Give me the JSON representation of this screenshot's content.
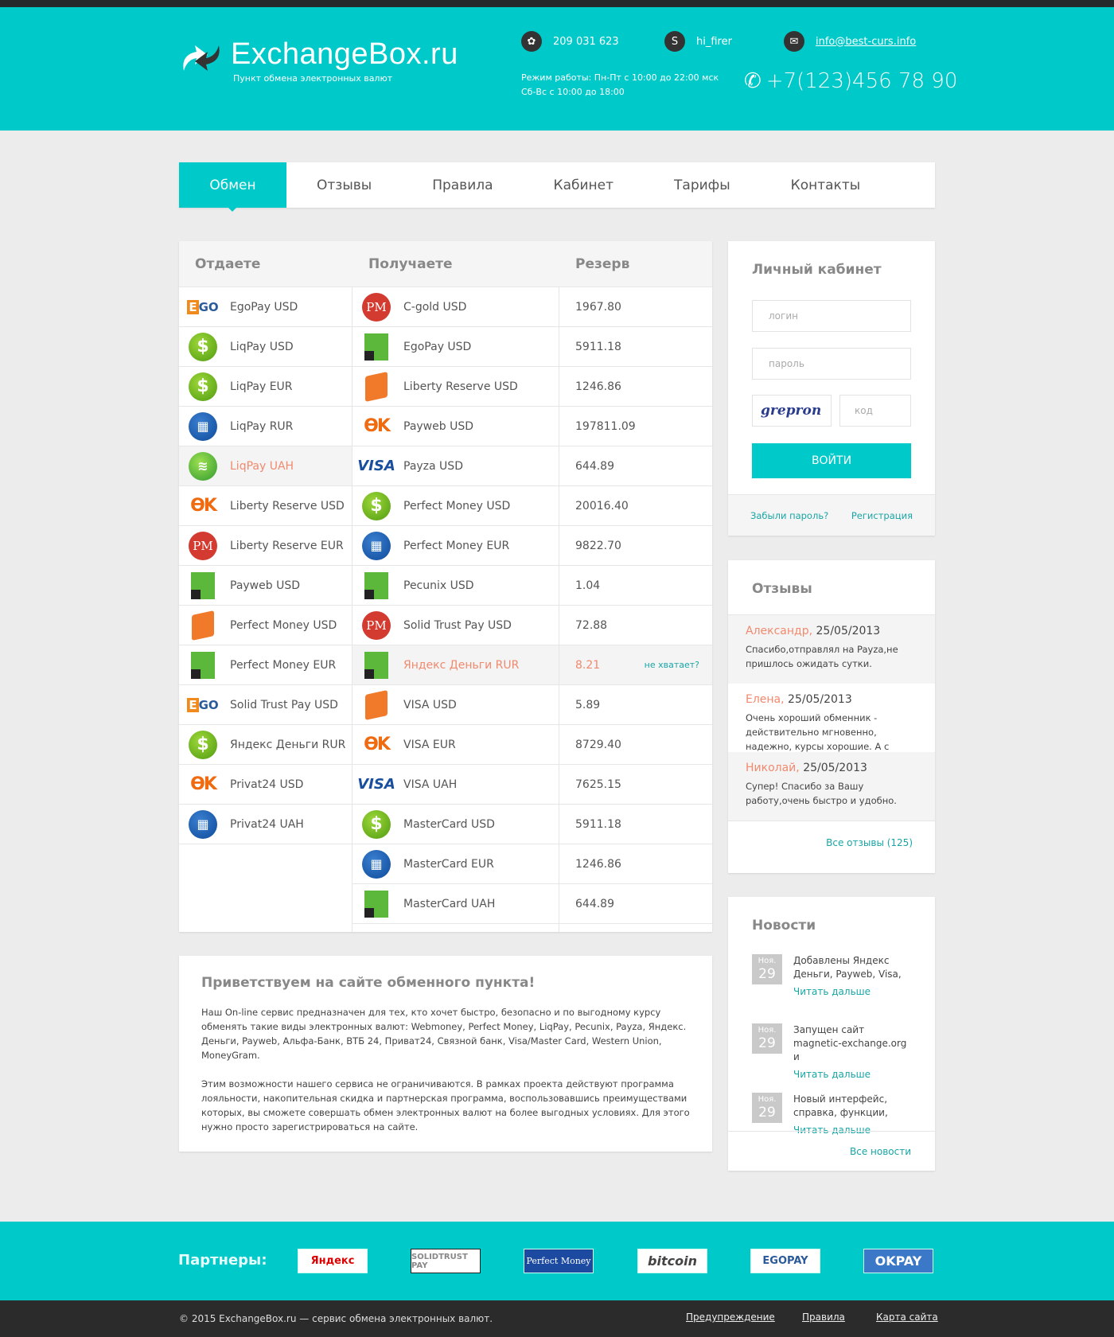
{
  "header": {
    "title": "ExchangeBox.ru",
    "subtitle": "Пункт обмена электронных валют",
    "icq": "209 031 623",
    "skype": "hi_firer",
    "email": "info@best-curs.info",
    "hours_line1": "Режим работы: Пн-Пт с 10:00 до 22:00 мск",
    "hours_line2": "Сб-Вс с 10:00 до 18:00",
    "phone": "+7(123)456 78 90"
  },
  "nav": {
    "tabs": [
      "Обмен",
      "Отзывы",
      "Правила",
      "Кабинет",
      "Тарифы",
      "Контакты"
    ],
    "active": 0
  },
  "table": {
    "headers": [
      "Отдаете",
      "Получаете",
      "Резерв"
    ],
    "give": [
      [
        "EgoPay USD",
        "egopay"
      ],
      [
        "LiqPay USD",
        "liqpay"
      ],
      [
        "LiqPay EUR",
        "liqpay"
      ],
      [
        "LiqPay RUR",
        "webmoney"
      ],
      [
        "LiqPay UAH",
        "sber"
      ],
      [
        "Liberty Reserve USD",
        "okpay"
      ],
      [
        "Liberty Reserve EUR",
        "pm"
      ],
      [
        "Payweb USD",
        "privat"
      ],
      [
        "Perfect Money USD",
        "wallet"
      ],
      [
        "Perfect Money EUR",
        "privat"
      ],
      [
        "Solid Trust Pay USD",
        "egopay"
      ],
      [
        "Яндекс Деньги RUR",
        "liqpay"
      ],
      [
        "Privat24 USD",
        "okpay"
      ],
      [
        "Privat24 UAH",
        "webmoney"
      ]
    ],
    "give_highlight": 4,
    "get": [
      [
        "C-gold USD",
        "pm",
        "1967.80"
      ],
      [
        "EgoPay USD",
        "privat",
        "5911.18"
      ],
      [
        "Liberty Reserve USD",
        "wallet",
        "1246.86"
      ],
      [
        "Payweb USD",
        "okpay",
        "197811.09"
      ],
      [
        "Payza USD",
        "visa",
        "644.89"
      ],
      [
        "Perfect Money USD",
        "liqpay",
        "20016.40"
      ],
      [
        "Perfect Money EUR",
        "webmoney",
        "9822.70"
      ],
      [
        "Pecunix USD",
        "privat",
        "1.04"
      ],
      [
        "Solid Trust Pay USD",
        "pm",
        "72.88"
      ],
      [
        "Яндекс Деньги RUR",
        "privat",
        "8.21"
      ],
      [
        "VISA USD",
        "wallet",
        "5.89"
      ],
      [
        "VISA EUR",
        "okpay",
        "8729.40"
      ],
      [
        "VISA UAH",
        "visa",
        "7625.15"
      ],
      [
        "MasterCard USD",
        "liqpay",
        "5911.18"
      ],
      [
        "MasterCard EUR",
        "webmoney",
        "1246.86"
      ],
      [
        "MasterCard UAH",
        "privat",
        "644.89"
      ]
    ],
    "get_highlight": 9,
    "shortage_label": "не хватает?"
  },
  "welcome": {
    "title": "Приветствуем на сайте обменного пункта!",
    "p1": "Наш On-line сервис предназначен для тех, кто хочет быстро, безопасно и по выгодному курсу обменять такие виды электронных валют: Webmoney, Perfect Money, LiqPay, Pecunix, Payza, Яндекс. Деньги, Payweb, Альфа-Банк, ВТБ 24, Приват24, Связной банк, Visa/Master Card, Western Union, MoneyGram.",
    "p2": "Этим возможности нашего сервиса не ограничиваются. В рамках проекта действуют программа лояльности, накопительная скидка и партнерская программа, воспользовавшись преимуществами которых, вы сможете совершать обмен электронных валют на более выгодных условиях. Для этого нужно просто зарегистрироваться на сайте."
  },
  "login": {
    "title": "Личный кабинет",
    "login_placeholder": "логин",
    "password_placeholder": "пароль",
    "captcha_text": "grepron",
    "code_placeholder": "код",
    "submit": "ВОЙТИ",
    "forgot": "Забыли пароль?",
    "register": "Регистрация"
  },
  "reviews": {
    "title": "Отзывы",
    "items": [
      {
        "name": "Александр,",
        "date": "25/05/2013",
        "text": "Спасибо,отправлял на Payza,не пришлось ожидать сутки."
      },
      {
        "name": "Елена,",
        "date": "25/05/2013",
        "text": "Очень хороший обменник - действительно мгновенно, надежно, курсы хорошие. А с"
      },
      {
        "name": "Николай,",
        "date": "25/05/2013",
        "text": "Супер! Спасибо за Вашу работу,очень быстро и удобно."
      }
    ],
    "all": "Все отзывы (125)"
  },
  "news": {
    "title": "Новости",
    "items": [
      {
        "month": "Ноя.",
        "day": "29",
        "text": "Добавлены Яндекс Деньги, Payweb, Visa,",
        "more": "Читать дальше"
      },
      {
        "month": "Ноя.",
        "day": "29",
        "text": "Запущен сайт magnetic-exchange.org и",
        "more": "Читать дальше"
      },
      {
        "month": "Ноя.",
        "day": "29",
        "text": "Новый интерфейс, справка, функции,",
        "more": "Читать дальше"
      }
    ],
    "all": "Все новости"
  },
  "partners": {
    "label": "Партнеры:",
    "logos": [
      "Яндекс",
      "SOLIDTRUST PAY",
      "Perfect Money",
      "bitcoin",
      "EGOPAY",
      "OKPAY"
    ]
  },
  "footer": {
    "copyright": "© 2015 ExchangeBox.ru — сервис обмена электронных валют.",
    "links": [
      "Предупреждение",
      "Правила",
      "Карта сайта"
    ]
  },
  "colors": {
    "accent": "#00c9c9",
    "highlight": "#f08a6e",
    "link": "#18a5a5"
  }
}
